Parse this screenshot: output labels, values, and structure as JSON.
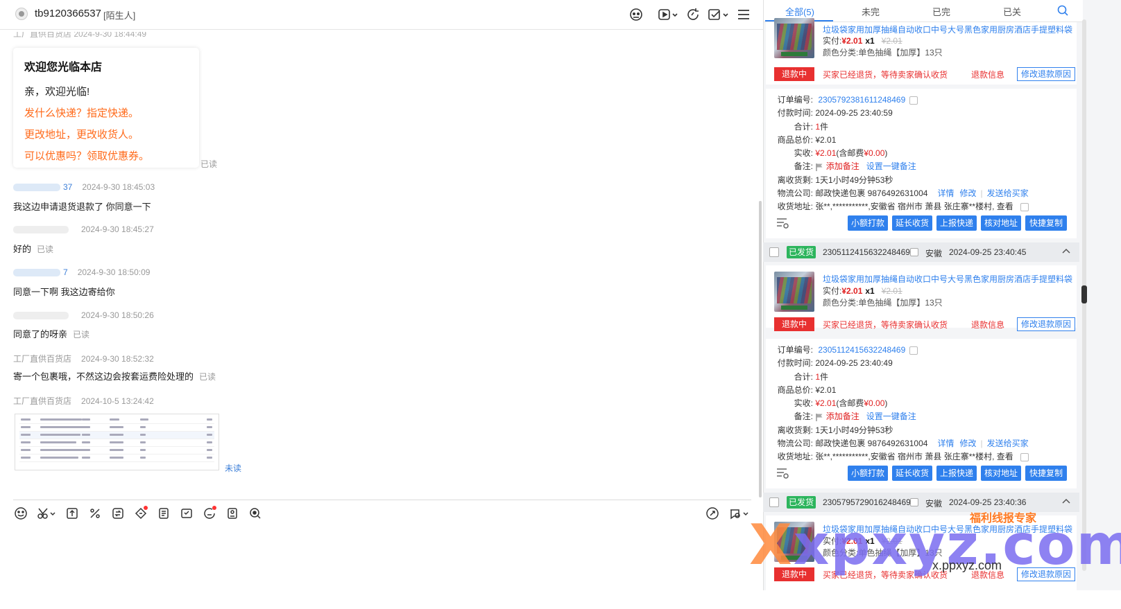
{
  "header": {
    "title": "tb9120366537",
    "tag": "[陌生人]"
  },
  "chat": {
    "welcome": {
      "title": "欢迎您光临本店",
      "lines": [
        "亲，欢迎光临!",
        "发什么快递？指定快递。",
        "更改地址，更改收货人。",
        "可以优惠吗？领取优惠券。"
      ],
      "read": "已读"
    },
    "messages": [
      {
        "sender": "37",
        "time": "2024-9-30 18:45:03",
        "text": "我这边申请退货退款了  你同意一下",
        "status": ""
      },
      {
        "sender": "",
        "time": "2024-9-30 18:45:27",
        "text": "好的",
        "status": "已读"
      },
      {
        "sender": "7",
        "time": "2024-9-30 18:50:09",
        "text": "同意一下啊  我这边寄给你",
        "status": ""
      },
      {
        "sender": "",
        "time": "2024-9-30 18:50:26",
        "text": "同意了的呀亲",
        "status": "已读"
      },
      {
        "sender": "工厂直供百货店",
        "time": "2024-9-30 18:52:32",
        "text": "寄一个包裹哦，不然这边会按套运费险处理的",
        "status": "已读"
      },
      {
        "sender": "工厂直供百货店",
        "time": "2024-10-5 13:24:42",
        "text": "",
        "status": "未读"
      }
    ]
  },
  "tabs": [
    "全部(5)",
    "未完",
    "已完",
    "已关"
  ],
  "product": {
    "title": "垃圾袋家用加厚抽绳自动收口中号大号黑色家用厨房酒店手提塑料袋",
    "paid_label": "实付:",
    "price": "¥2.01",
    "qty": "x1",
    "orig_price": "¥2.01",
    "variant": "颜色分类:单色抽绳【加厚】13只",
    "refund_badge": "退款中",
    "refund_msg": "买家已经退货，等待卖家确认收货",
    "refund_info": "退款信息",
    "modify_reason": "修改退款原因"
  },
  "orders": [
    {
      "order_no": "2305792381611248469",
      "pay_time": "2024-09-25 23:40:59",
      "header": null
    },
    {
      "order_no": "2305112415632248469",
      "pay_time": "2024-09-25 23:40:49",
      "header": {
        "status": "已发货",
        "order_no": "2305112415632248469",
        "province": "安徽",
        "time": "2024-09-25 23:40:45"
      }
    }
  ],
  "order_detail": {
    "labels": {
      "order_no": "订单编号:",
      "pay_time": "付款时间:",
      "total": "合计:",
      "goods_total": "商品总价:",
      "received": "实收:",
      "remark": "备注:",
      "receipt_left": "离收货剩:",
      "logistics": "物流公司:",
      "address": "收货地址:"
    },
    "count": "1",
    "count_unit": "件",
    "goods_total": "¥2.01",
    "received": "¥2.01",
    "postage": "(含邮费",
    "postage_val": "¥0.00",
    "postage_end": ")",
    "add_remark": "添加备注",
    "one_click_remark": "设置一键备注",
    "receipt_left": "1天1小时49分钟53秒",
    "logistics": "邮政快递包裹 9876492631004",
    "detail": "详情",
    "modify": "修改",
    "send_to_buyer": "发送给买家",
    "address": "张**,***********,安徽省 宿州市 萧县 张庄寨**楼村, 查看",
    "actions": [
      "小额打款",
      "延长收货",
      "上报快递",
      "核对地址",
      "快捷复制"
    ]
  },
  "order3_header": {
    "status": "已发货",
    "order_no": "2305795729016248469",
    "province": "安徽",
    "time": "2024-09-25 23:40:36"
  },
  "watermark": {
    "big": "xpxyz.com",
    "small": "x.ppxyz.com",
    "brand": "福利线报专家"
  },
  "colors": {
    "accent": "#2f80ed",
    "refund": "#e83030",
    "shipped": "#2db55d",
    "highlight": "#ff6a1a"
  }
}
